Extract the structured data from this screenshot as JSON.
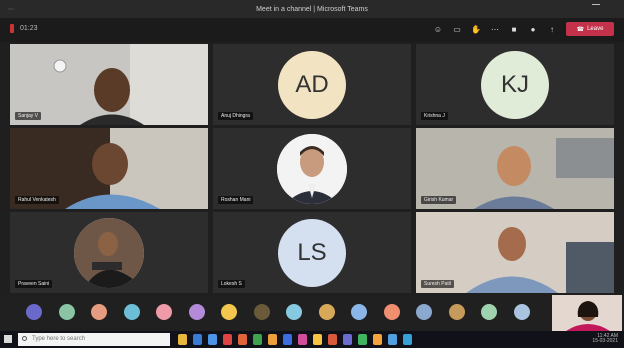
{
  "window": {
    "title": "Meet in a channel | Microsoft Teams"
  },
  "toolbar": {
    "timer": "01:23",
    "leave_label": "Leave",
    "icons": [
      "people-icon",
      "chat-icon",
      "raise-hand-icon",
      "more-icon",
      "camera-icon",
      "mic-icon",
      "share-icon"
    ]
  },
  "participants": [
    {
      "name": "Sanjay V",
      "kind": "video"
    },
    {
      "name": "Anuj Dhingra",
      "kind": "initials",
      "initials": "AD",
      "color": "#f2e3c2"
    },
    {
      "name": "Krishna J",
      "kind": "initials",
      "initials": "KJ",
      "color": "#e1ecd8"
    },
    {
      "name": "Rahul Venkatesh",
      "kind": "video"
    },
    {
      "name": "Roshan Mani",
      "kind": "photo"
    },
    {
      "name": "Girish Kumar",
      "kind": "video"
    },
    {
      "name": "Praveen Saini",
      "kind": "photo"
    },
    {
      "name": "Lokesh S",
      "kind": "initials",
      "initials": "LS",
      "color": "#d4e0ef"
    },
    {
      "name": "Suresh Patil",
      "kind": "video"
    }
  ],
  "strip": {
    "avatar_colors": [
      "#6a6acd",
      "#8bc4a4",
      "#e89c7f",
      "#6cbfd6",
      "#ee9aa8",
      "#b38bd8",
      "#f3c64e",
      "#6b5a3a",
      "#86c9e0",
      "#d6a85a",
      "#8ab6e8",
      "#ef8f6f",
      "#8ba8cf",
      "#c69a5a",
      "#9fd3b0",
      "#a8c4e0"
    ]
  },
  "taskbar": {
    "search_placeholder": "Type here to search",
    "time": "11:42 AM",
    "date": "15-03-2021",
    "app_colors": [
      "#e8b83c",
      "#3a7bd5",
      "#4b94e8",
      "#d44",
      "#e0643a",
      "#3fa34d",
      "#ed9e3a",
      "#3c6de0",
      "#d34c9a",
      "#f6c343",
      "#d85a3a",
      "#6b6bd0",
      "#3fb35e",
      "#f3a43c",
      "#50a0e0",
      "#37a0d8"
    ]
  }
}
